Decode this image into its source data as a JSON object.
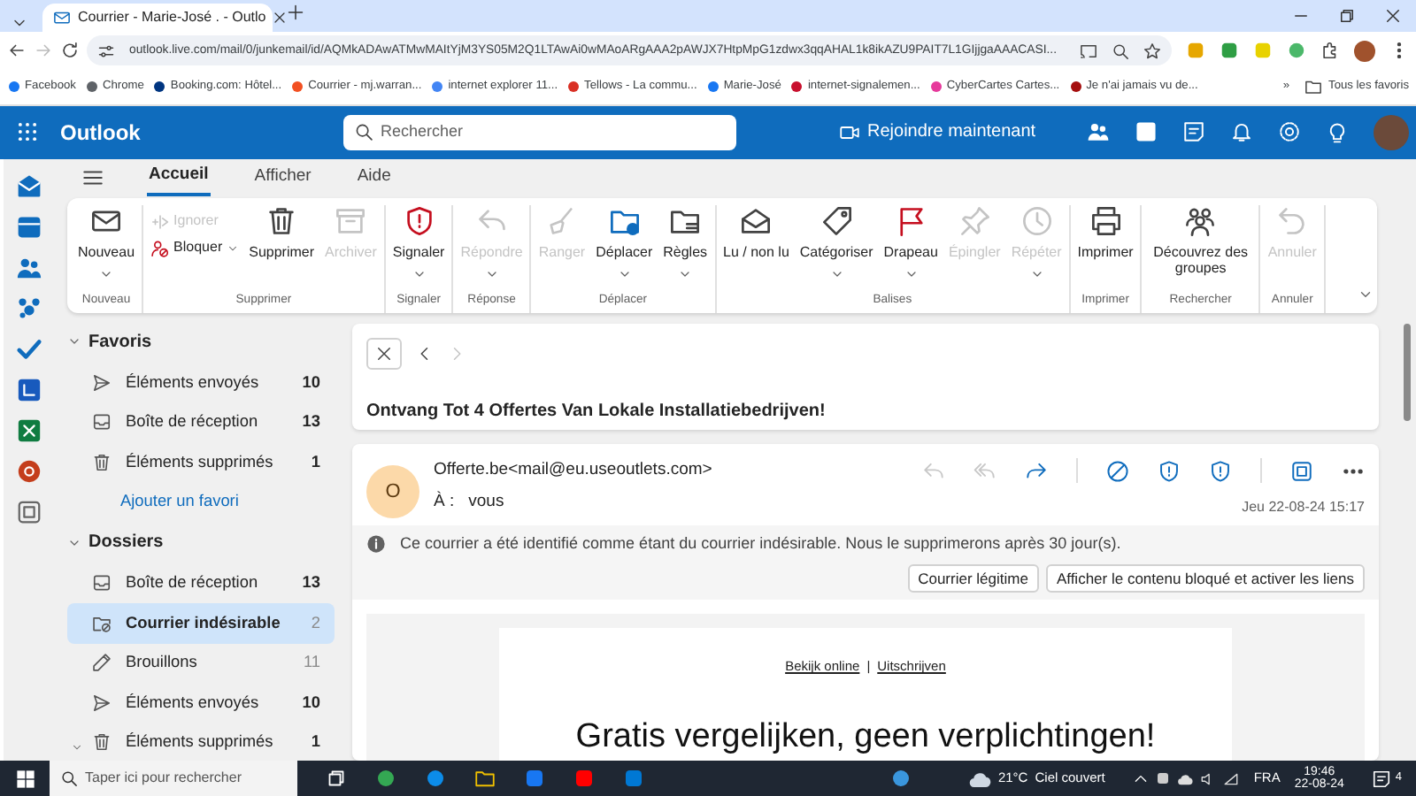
{
  "browser": {
    "tab_title": "Courrier - Marie-José . - Outlo",
    "url": "outlook.live.com/mail/0/junkemail/id/AQMkADAwATMwMAItYjM3YS05M2Q1LTAwAi0wMAoARgAAA2pAWJX7HtpMpG1zdwx3qqAHAL1k8ikAZU9PAIT7L1GIjjgaAAACASI...",
    "bookmarks": [
      {
        "label": "Facebook",
        "color": "#1877f2"
      },
      {
        "label": "Chrome",
        "color": "#5f6368"
      },
      {
        "label": "Booking.com: Hôtel...",
        "color": "#003580"
      },
      {
        "label": "Courrier - mj.warran...",
        "color": "#f25022"
      },
      {
        "label": "internet explorer 11...",
        "color": "#4285f4"
      },
      {
        "label": "Tellows - La commu...",
        "color": "#d93025"
      },
      {
        "label": "Marie-José",
        "color": "#1877f2"
      },
      {
        "label": "internet-signalemen...",
        "color": "#c8102e"
      },
      {
        "label": "CyberCartes Cartes...",
        "color": "#e6399b"
      },
      {
        "label": "Je n'ai jamais vu de...",
        "color": "#a50e0e"
      }
    ],
    "more_bookmarks": "»",
    "all_bookmarks": "Tous les favoris"
  },
  "app": {
    "name": "Outlook",
    "search_placeholder": "Rechercher",
    "join": "Rejoindre maintenant"
  },
  "ribbon_tabs": [
    {
      "label": "Accueil",
      "selected": true
    },
    {
      "label": "Afficher",
      "selected": false
    },
    {
      "label": "Aide",
      "selected": false
    }
  ],
  "ribbon_groups": [
    {
      "label": "Nouveau",
      "buttons": [
        {
          "label": "Nouveau",
          "kind": "large",
          "disabled": false,
          "caret": true
        }
      ]
    },
    {
      "label": "Supprimer",
      "buttons": [
        {
          "label": "Ignorer",
          "kind": "small",
          "disabled": true,
          "caret": false
        },
        {
          "label": "Bloquer",
          "kind": "small",
          "disabled": false,
          "caret": true
        },
        {
          "label": "Supprimer",
          "kind": "large",
          "disabled": false,
          "caret": false
        },
        {
          "label": "Archiver",
          "kind": "large",
          "disabled": true,
          "caret": false
        }
      ]
    },
    {
      "label": "Signaler",
      "buttons": [
        {
          "label": "Signaler",
          "kind": "large",
          "disabled": false,
          "caret": true
        }
      ]
    },
    {
      "label": "Réponse",
      "buttons": [
        {
          "label": "Répondre",
          "kind": "large",
          "disabled": true,
          "caret": true
        }
      ]
    },
    {
      "label": "Déplacer",
      "buttons": [
        {
          "label": "Ranger",
          "kind": "large",
          "disabled": true,
          "caret": false
        },
        {
          "label": "Déplacer",
          "kind": "large",
          "disabled": false,
          "caret": true
        },
        {
          "label": "Règles",
          "kind": "large",
          "disabled": false,
          "caret": true
        }
      ]
    },
    {
      "label": "Balises",
      "buttons": [
        {
          "label": "Lu / non lu",
          "kind": "large",
          "disabled": false,
          "caret": false
        },
        {
          "label": "Catégoriser",
          "kind": "large",
          "disabled": false,
          "caret": true
        },
        {
          "label": "Drapeau",
          "kind": "large",
          "disabled": false,
          "caret": true
        },
        {
          "label": "Épingler",
          "kind": "large",
          "disabled": true,
          "caret": false
        },
        {
          "label": "Répéter",
          "kind": "large",
          "disabled": true,
          "caret": true
        }
      ]
    },
    {
      "label": "Imprimer",
      "buttons": [
        {
          "label": "Imprimer",
          "kind": "large",
          "disabled": false,
          "caret": false
        }
      ]
    },
    {
      "label": "Rechercher",
      "buttons": [
        {
          "label": "Découvrez des groupes",
          "kind": "large",
          "disabled": false,
          "caret": false
        }
      ]
    },
    {
      "label": "Annuler",
      "buttons": [
        {
          "label": "Annuler",
          "kind": "large",
          "disabled": true,
          "caret": false
        }
      ]
    }
  ],
  "folder_sections": [
    {
      "title": "Favoris",
      "expanded": true,
      "items": [
        {
          "label": "Éléments envoyés",
          "count": "10",
          "selected": false,
          "muted": false,
          "expander": false
        },
        {
          "label": "Boîte de réception",
          "count": "13",
          "selected": false,
          "muted": false,
          "expander": false
        },
        {
          "label": "Éléments supprimés",
          "count": "1",
          "selected": false,
          "muted": false,
          "expander": false
        }
      ],
      "add_link": "Ajouter un favori"
    },
    {
      "title": "Dossiers",
      "expanded": true,
      "items": [
        {
          "label": "Boîte de réception",
          "count": "13",
          "selected": false,
          "muted": false,
          "expander": false
        },
        {
          "label": "Courrier indésirable",
          "count": "2",
          "selected": true,
          "muted": true,
          "expander": false
        },
        {
          "label": "Brouillons",
          "count": "11",
          "selected": false,
          "muted": true,
          "expander": false
        },
        {
          "label": "Éléments envoyés",
          "count": "10",
          "selected": false,
          "muted": false,
          "expander": false
        },
        {
          "label": "Éléments supprimés",
          "count": "1",
          "selected": false,
          "muted": false,
          "expander": true
        }
      ]
    }
  ],
  "message": {
    "back_disabled": false,
    "forward_disabled": true,
    "subject": "Ontvang Tot 4 Offertes Van Lokale Installatiebedrijven!",
    "avatar_letter": "O",
    "sender": "Offerte.be<mail@eu.useoutlets.com>",
    "to_label": "À :",
    "to": "vous",
    "date": "Jeu 22-08-24 15:17",
    "actions": [
      {
        "disabled": true
      },
      {
        "disabled": true
      },
      {
        "disabled": false
      },
      {
        "disabled": false
      },
      {
        "disabled": false
      },
      {
        "disabled": false
      },
      {
        "disabled": false
      },
      {
        "disabled": false
      }
    ],
    "notice": "Ce courrier a été identifié comme étant du courrier indésirable. Nous le supprimerons après 30 jour(s).",
    "buttons": [
      "Courrier légitime",
      "Afficher le contenu bloqué et activer les liens"
    ],
    "body_links": [
      "Bekijk online",
      "Uitschrijven"
    ],
    "link_separator": "|",
    "headline": "Gratis vergelijken, geen verplichtingen!"
  },
  "taskbar": {
    "search_placeholder": "Taper ici pour rechercher",
    "temperature": "21°C",
    "weather": "Ciel couvert",
    "language": "FRA",
    "time": "19:46",
    "date": "22-08-24",
    "notifications": "4"
  }
}
